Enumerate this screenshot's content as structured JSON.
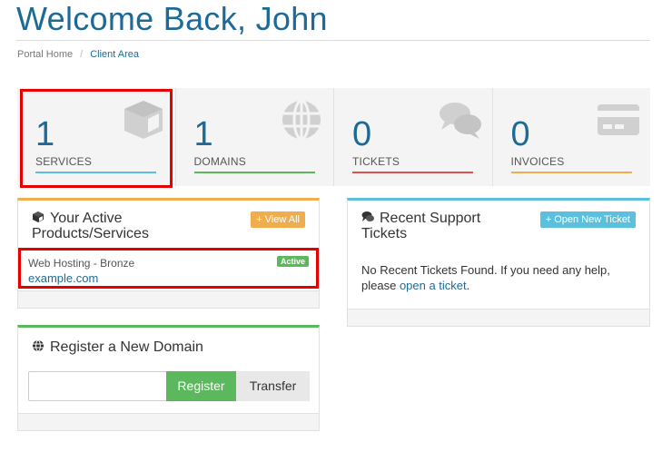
{
  "page": {
    "title": "Welcome Back, John"
  },
  "breadcrumb": {
    "home": "Portal Home",
    "separator": "/",
    "current": "Client Area"
  },
  "stats": [
    {
      "count": "1",
      "label": "SERVICES",
      "color": "#5bc0de",
      "icon": "cube-icon"
    },
    {
      "count": "1",
      "label": "DOMAINS",
      "color": "#5cb85c",
      "icon": "globe-icon"
    },
    {
      "count": "0",
      "label": "TICKETS",
      "color": "#d9534f",
      "icon": "chat-bubbles-icon"
    },
    {
      "count": "0",
      "label": "INVOICES",
      "color": "#f0ad4e",
      "icon": "credit-card-icon"
    }
  ],
  "products_panel": {
    "title_line1": "Your Active",
    "title_line2": "Products/Services",
    "view_all": "+ View All",
    "service_name": "Web Hosting - Bronze",
    "service_domain": "example.com",
    "status": "Active",
    "accent": "#f0ad4e"
  },
  "tickets_panel": {
    "title_line1": "Recent Support",
    "title_line2": "Tickets",
    "open_new": "+ Open New Ticket",
    "message": "No Recent Tickets Found. If you need any help, please",
    "link": "open a ticket",
    "trailing": ".",
    "accent": "#5bc0de"
  },
  "domain_panel": {
    "title": "Register a New Domain",
    "input_value": "",
    "register": "Register",
    "transfer": "Transfer",
    "accent": "#5cb85c"
  }
}
